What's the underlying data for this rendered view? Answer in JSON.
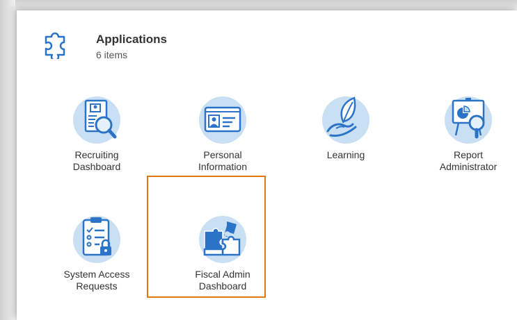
{
  "header": {
    "title": "Applications",
    "subtitle": "6 items",
    "icon": "puzzle-piece-icon"
  },
  "apps": [
    {
      "label": "Recruiting\nDashboard",
      "icon": "resume-search-icon"
    },
    {
      "label": "Personal\nInformation",
      "icon": "id-card-icon"
    },
    {
      "label": "Learning",
      "icon": "hand-leaf-icon"
    },
    {
      "label": "Report\nAdministrator",
      "icon": "presentation-chart-icon"
    },
    {
      "label": "System Access\nRequests",
      "icon": "clipboard-lock-icon"
    },
    {
      "label": "Fiscal Admin\nDashboard",
      "icon": "puzzle-pieces-icon"
    }
  ],
  "colors": {
    "accent_highlight": "#e07a10",
    "icon_blue": "#2b73c7",
    "icon_light": "#c9dff4"
  }
}
